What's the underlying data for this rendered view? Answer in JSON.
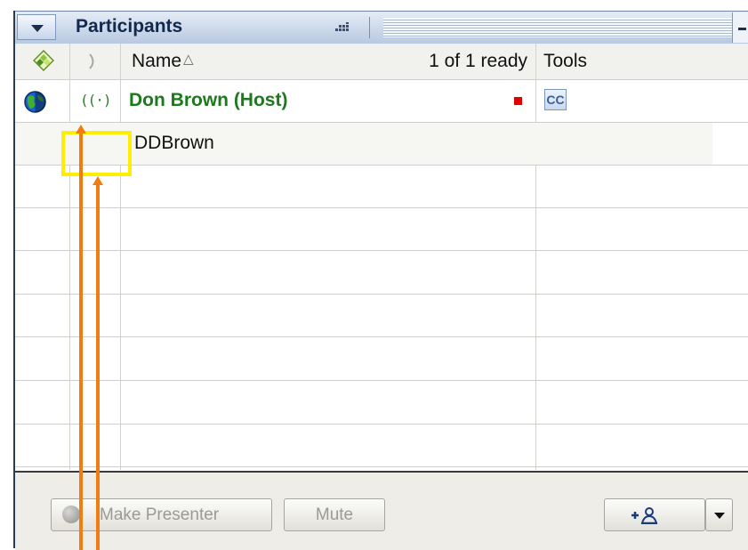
{
  "header": {
    "title": "Participants",
    "collapse_icon": "triangle-down-icon",
    "grip_icon": "grip-dots-icon",
    "minimize_icon": "minimize-icon"
  },
  "columns": {
    "status_icon": "diamond-status-icon",
    "audio_icon": "audio-column-icon",
    "name": "Name",
    "sort_icon": "△",
    "ready": "1 of 1 ready",
    "tools": "Tools"
  },
  "participants": [
    {
      "name": "Don Brown (Host)",
      "status_icon": "globe-icon",
      "audio_icon": "audio-waves-icon",
      "audio_glyph": "((·)",
      "marker_color": "#e30000",
      "tool_label": "CC",
      "name_color": "#1c7a1c"
    }
  ],
  "sub_row": {
    "name": "DDBrown"
  },
  "footer": {
    "make_presenter": "Make Presenter",
    "mute": "Mute",
    "invite_icon": "add-person-icon",
    "invite_plus": "+",
    "dropdown_icon": "chevron-down-icon"
  },
  "annotation": {
    "highlight_color": "#ffee00",
    "arrow_color": "#f07c12"
  }
}
